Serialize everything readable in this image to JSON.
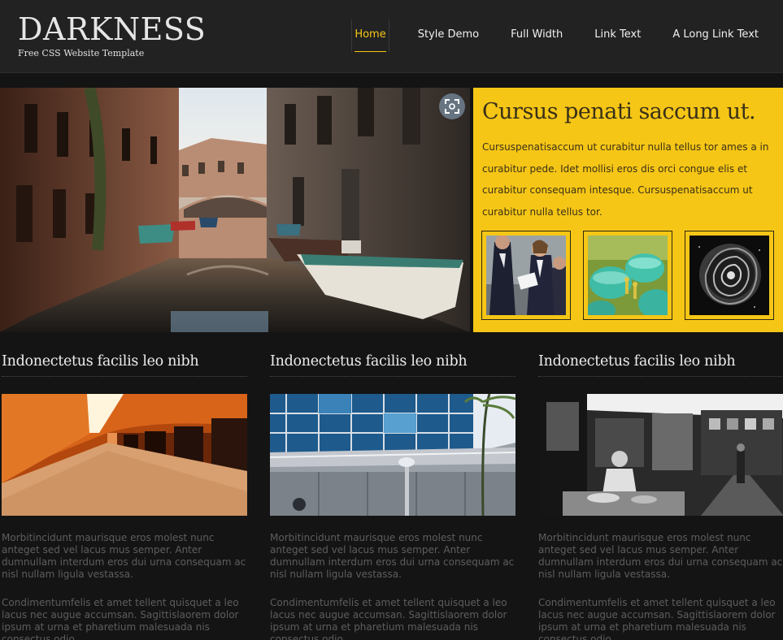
{
  "header": {
    "logo_title": "DARKNESS",
    "logo_tagline": "Free CSS Website Template",
    "nav": [
      {
        "label": "Home",
        "active": true
      },
      {
        "label": "Style Demo",
        "active": false
      },
      {
        "label": "Full Width",
        "active": false
      },
      {
        "label": "Link Text",
        "active": false
      },
      {
        "label": "A Long Link Text",
        "active": false
      }
    ]
  },
  "hero": {
    "image_icon": "canal-photo",
    "expand_icon": "expand-icon",
    "title": "Cursus penati saccum ut.",
    "text": "Cursuspenatisaccum ut curabitur nulla tellus tor ames a in curabitur pede. Idet mollisi eros dis orci congue elis et curabitur consequam intesque. Cursuspenatisaccum ut curabitur nulla tellus tor.",
    "thumbnails": [
      "business-people-thumb",
      "green-domes-thumb",
      "black-rose-thumb"
    ]
  },
  "columns": [
    {
      "title": "Indonectetus facilis leo nibh",
      "image": "orange-tunnel-photo",
      "p1": "Morbitincidunt maurisque eros molest nunc anteget sed vel lacus mus semper. Anter dumnullam interdum eros dui urna consequam ac nisl nullam ligula vestassa.",
      "p2": "Condimentumfelis et amet tellent quisquet a leo lacus nec augue accumsan. Sagittislaorem dolor ipsum at urna et pharetium malesuada nis consectus odio."
    },
    {
      "title": "Indonectetus facilis leo nibh",
      "image": "building-facade-photo",
      "p1": "Morbitincidunt maurisque eros molest nunc anteget sed vel lacus mus semper. Anter dumnullam interdum eros dui urna consequam ac nisl nullam ligula vestassa.",
      "p2": "Condimentumfelis et amet tellent quisquet a leo lacus nec augue accumsan. Sagittislaorem dolor ipsum at urna et pharetium malesuada nis consectus odio."
    },
    {
      "title": "Indonectetus facilis leo nibh",
      "image": "market-stall-photo",
      "p1": "Morbitincidunt maurisque eros molest nunc anteget sed vel lacus mus semper. Anter dumnullam interdum eros dui urna consequam ac nisl nullam ligula vestassa.",
      "p2": "Condimentumfelis et amet tellent quisquet a leo lacus nec augue accumsan. Sagittislaorem dolor ipsum at urna et pharetium malesuada nis consectus odio."
    }
  ],
  "colors": {
    "accent": "#f6c616",
    "header_bg": "#222222",
    "page_bg": "#141414"
  }
}
